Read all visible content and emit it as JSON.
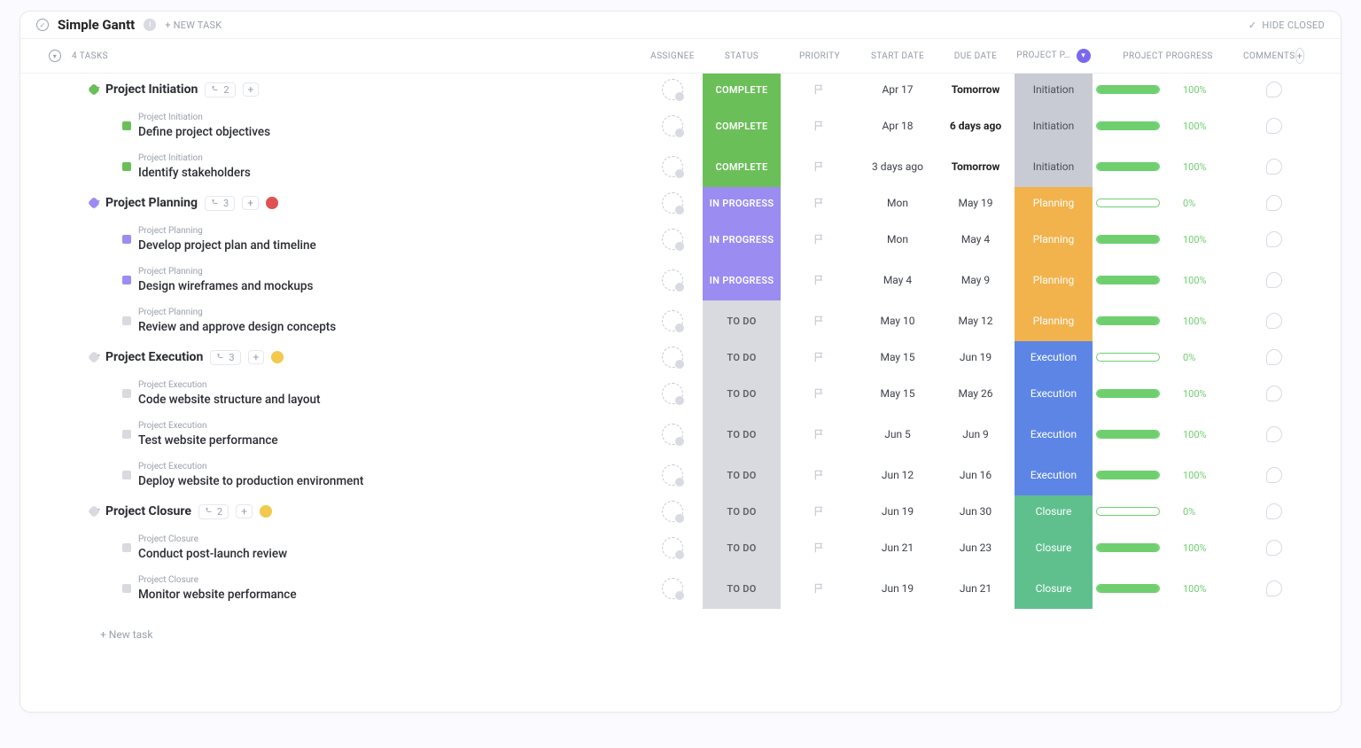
{
  "topbar": {
    "title": "Simple Gantt",
    "new_task_label": "+ NEW TASK",
    "hide_closed_label": "HIDE CLOSED"
  },
  "header": {
    "tasks_count_label": "4 TASKS",
    "assignee": "ASSIGNEE",
    "status": "STATUS",
    "priority": "PRIORITY",
    "start_date": "START DATE",
    "due_date": "DUE DATE",
    "project_phase": "PROJECT P…",
    "project_progress": "PROJECT PROGRESS",
    "comments": "COMMENTS"
  },
  "groups": [
    {
      "name": "Project Initiation",
      "color_cls": "sq-green",
      "subcount": "2",
      "ext_badge_color": "",
      "status": {
        "label": "COMPLETE",
        "cls": "st-complete"
      },
      "start": "Apr 17",
      "due": "Tomorrow",
      "due_bold": true,
      "phase": {
        "label": "Initiation",
        "cls": "ph-init"
      },
      "progress": 100,
      "tasks": [
        {
          "bread": "Project Initiation",
          "title": "Define project objectives",
          "color_cls": "sq-green",
          "status": {
            "label": "COMPLETE",
            "cls": "st-complete"
          },
          "start": "Apr 18",
          "due": "6 days ago",
          "due_bold": true,
          "phase": {
            "label": "Initiation",
            "cls": "ph-init"
          },
          "progress": 100
        },
        {
          "bread": "Project Initiation",
          "title": "Identify stakeholders",
          "color_cls": "sq-green",
          "status": {
            "label": "COMPLETE",
            "cls": "st-complete"
          },
          "start": "3 days ago",
          "due": "Tomorrow",
          "due_bold": true,
          "phase": {
            "label": "Initiation",
            "cls": "ph-init"
          },
          "progress": 100
        }
      ]
    },
    {
      "name": "Project Planning",
      "color_cls": "sq-purple",
      "subcount": "3",
      "ext_badge_color": "#e05252",
      "status": {
        "label": "IN PROGRESS",
        "cls": "st-progress"
      },
      "start": "Mon",
      "due": "May 19",
      "due_bold": false,
      "phase": {
        "label": "Planning",
        "cls": "ph-plan"
      },
      "progress": 0,
      "tasks": [
        {
          "bread": "Project Planning",
          "title": "Develop project plan and timeline",
          "color_cls": "sq-purple",
          "status": {
            "label": "IN PROGRESS",
            "cls": "st-progress"
          },
          "start": "Mon",
          "due": "May 4",
          "due_bold": false,
          "phase": {
            "label": "Planning",
            "cls": "ph-plan"
          },
          "progress": 100
        },
        {
          "bread": "Project Planning",
          "title": "Design wireframes and mockups",
          "color_cls": "sq-purple",
          "status": {
            "label": "IN PROGRESS",
            "cls": "st-progress"
          },
          "start": "May 4",
          "due": "May 9",
          "due_bold": false,
          "phase": {
            "label": "Planning",
            "cls": "ph-plan"
          },
          "progress": 100
        },
        {
          "bread": "Project Planning",
          "title": "Review and approve design concepts",
          "color_cls": "sq-grey",
          "status": {
            "label": "TO DO",
            "cls": "st-todo"
          },
          "start": "May 10",
          "due": "May 12",
          "due_bold": false,
          "phase": {
            "label": "Planning",
            "cls": "ph-plan"
          },
          "progress": 100
        }
      ]
    },
    {
      "name": "Project Execution",
      "color_cls": "sq-grey",
      "subcount": "3",
      "ext_badge_color": "#f2c94c",
      "status": {
        "label": "TO DO",
        "cls": "st-todo"
      },
      "start": "May 15",
      "due": "Jun 19",
      "due_bold": false,
      "phase": {
        "label": "Execution",
        "cls": "ph-exec"
      },
      "progress": 0,
      "tasks": [
        {
          "bread": "Project Execution",
          "title": "Code website structure and layout",
          "color_cls": "sq-grey",
          "status": {
            "label": "TO DO",
            "cls": "st-todo"
          },
          "start": "May 15",
          "due": "May 26",
          "due_bold": false,
          "phase": {
            "label": "Execution",
            "cls": "ph-exec"
          },
          "progress": 100
        },
        {
          "bread": "Project Execution",
          "title": "Test website performance",
          "color_cls": "sq-grey",
          "status": {
            "label": "TO DO",
            "cls": "st-todo"
          },
          "start": "Jun 5",
          "due": "Jun 9",
          "due_bold": false,
          "phase": {
            "label": "Execution",
            "cls": "ph-exec"
          },
          "progress": 100
        },
        {
          "bread": "Project Execution",
          "title": "Deploy website to production environment",
          "color_cls": "sq-grey",
          "status": {
            "label": "TO DO",
            "cls": "st-todo"
          },
          "start": "Jun 12",
          "due": "Jun 16",
          "due_bold": false,
          "phase": {
            "label": "Execution",
            "cls": "ph-exec"
          },
          "progress": 100
        }
      ]
    },
    {
      "name": "Project Closure",
      "color_cls": "sq-grey",
      "subcount": "2",
      "ext_badge_color": "#f2c94c",
      "status": {
        "label": "TO DO",
        "cls": "st-todo"
      },
      "start": "Jun 19",
      "due": "Jun 30",
      "due_bold": false,
      "phase": {
        "label": "Closure",
        "cls": "ph-close"
      },
      "progress": 0,
      "tasks": [
        {
          "bread": "Project Closure",
          "title": "Conduct post-launch review",
          "color_cls": "sq-grey",
          "status": {
            "label": "TO DO",
            "cls": "st-todo"
          },
          "start": "Jun 21",
          "due": "Jun 23",
          "due_bold": false,
          "phase": {
            "label": "Closure",
            "cls": "ph-close"
          },
          "progress": 100
        },
        {
          "bread": "Project Closure",
          "title": "Monitor website performance",
          "color_cls": "sq-grey",
          "status": {
            "label": "TO DO",
            "cls": "st-todo"
          },
          "start": "Jun 19",
          "due": "Jun 21",
          "due_bold": false,
          "phase": {
            "label": "Closure",
            "cls": "ph-close"
          },
          "progress": 100
        }
      ]
    }
  ],
  "footer": {
    "new_task": "+ New task"
  }
}
